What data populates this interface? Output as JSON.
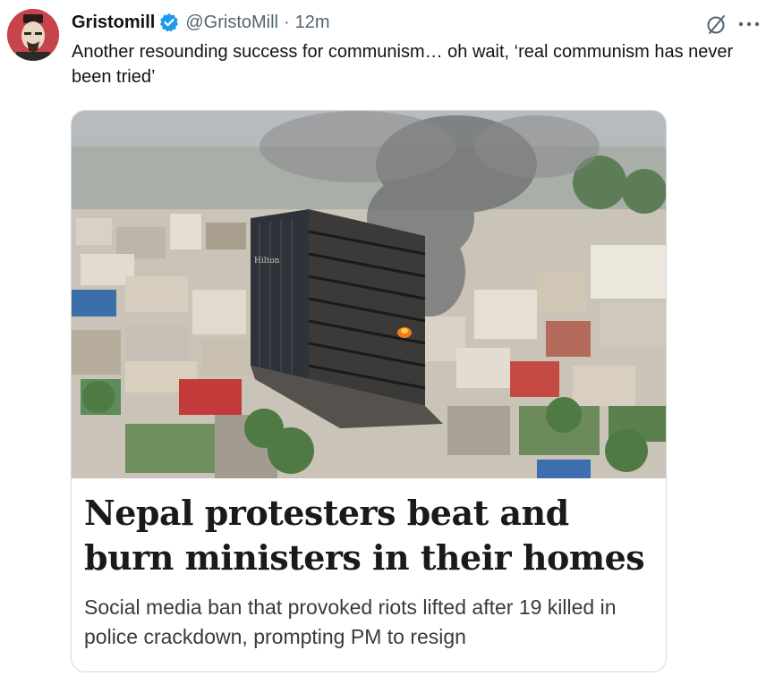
{
  "tweet": {
    "display_name": "Gristomill",
    "verified": true,
    "handle": "@GristoMill",
    "separator": "·",
    "time": "12m",
    "text": "Another resounding success for communism… oh wait, ‘real communism has never been tried’"
  },
  "icons": {
    "avatar": "avatar-portrait",
    "verified": "verified-badge-icon",
    "grok": "grok-icon",
    "more": "more-options-icon"
  },
  "card": {
    "image_sign": "Hilton",
    "headline": "Nepal protesters beat and burn ministers in their homes",
    "standfirst": "Social media ban that provoked riots lifted after 19 killed in police crackdown, prompting PM to resign"
  },
  "colors": {
    "verified_badge": "#1d9bf0",
    "avatar_bg": "#c8444c",
    "secondary_text": "#536471",
    "card_border": "#cfd9de"
  }
}
